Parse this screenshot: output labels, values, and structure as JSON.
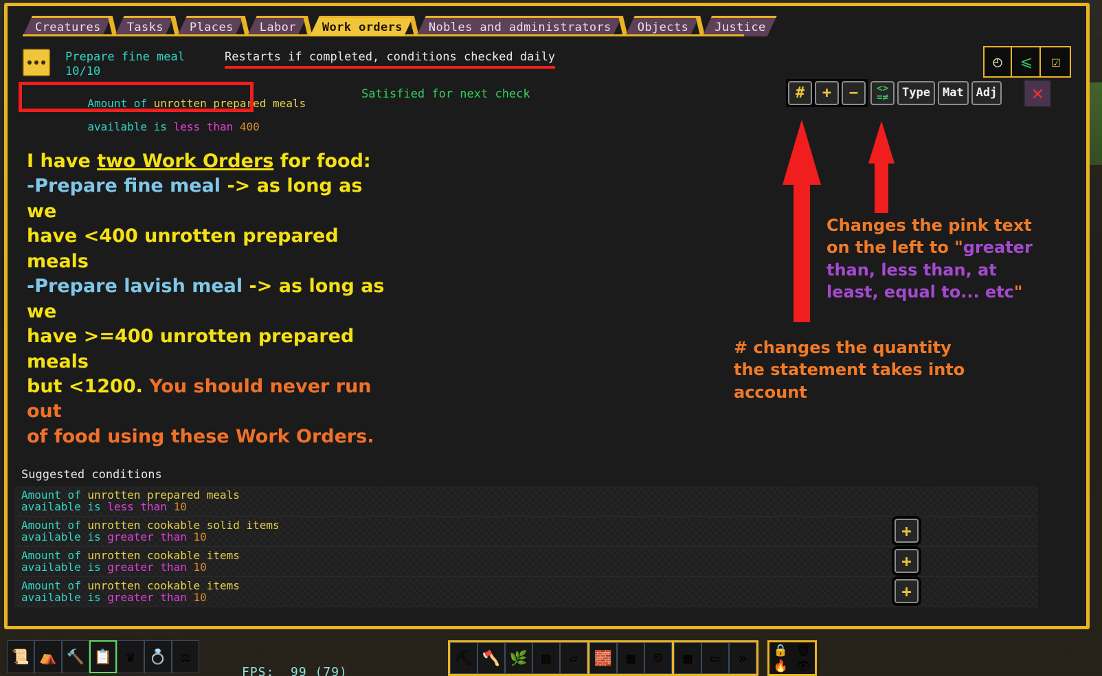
{
  "tabs": [
    {
      "label": "Creatures",
      "active": false
    },
    {
      "label": "Tasks",
      "active": false
    },
    {
      "label": "Places",
      "active": false
    },
    {
      "label": "Labor",
      "active": false
    },
    {
      "label": "Work orders",
      "active": true
    },
    {
      "label": "Nobles and administrators",
      "active": false
    },
    {
      "label": "Objects",
      "active": false
    },
    {
      "label": "Justice",
      "active": false
    }
  ],
  "order": {
    "title": "Prepare fine meal",
    "progress": "10/10",
    "restart_note": "Restarts if completed, conditions checked daily",
    "icon_name": "work-order-dots-icon",
    "status": "Satisfied for next check"
  },
  "active_condition": {
    "seg1": "Amount of ",
    "seg2": "unrotten prepared meals",
    "seg3": "available is ",
    "comparator": "less than",
    "value": "400"
  },
  "header_icons": [
    {
      "name": "clock-icon",
      "glyph": "⏱"
    },
    {
      "name": "comparison-add-icon",
      "glyph": "≤"
    },
    {
      "name": "clipboard-add-icon",
      "glyph": "☑"
    }
  ],
  "condition_toolbar": {
    "quantity_label": "#",
    "increment_label": "+",
    "decrement_label": "−",
    "comparator_glyph": [
      "<",
      ">",
      "=",
      "≠"
    ],
    "type_label": "Type",
    "mat_label": "Mat",
    "adj_label": "Adj",
    "close_label": "✕"
  },
  "annotations": {
    "main": {
      "line1_a": "I have ",
      "line1_b": "two Work Orders",
      "line1_c": " for food:",
      "line2_a": "-Prepare fine meal",
      "line2_b": " -> as long as we",
      "line3": "have <400 unrotten prepared meals",
      "line4_a": "-Prepare lavish meal",
      "line4_b": " -> as long as we",
      "line5": "have >=400 unrotten prepared meals",
      "line6_a": "but <1200. ",
      "line6_b": "You should never run out",
      "line7": "of food using these Work Orders."
    },
    "right": {
      "a": "Changes the pink text on the left to \"",
      "b": "greater than, less than, at least, equal to... etc",
      "c": "\""
    },
    "bottom": "# changes the quantity the statement takes into account"
  },
  "suggested": {
    "title": "Suggested conditions",
    "rows": [
      {
        "seg1": "Amount of ",
        "seg2": "unrotten prepared meals",
        "seg3": "available is ",
        "comparator": "less than",
        "value": "10",
        "has_add": false,
        "add_label": "+"
      },
      {
        "seg1": "Amount of ",
        "seg2": "unrotten cookable solid items",
        "seg3": "available is ",
        "comparator": "greater than",
        "value": "10",
        "has_add": true,
        "add_label": "+"
      },
      {
        "seg1": "Amount of ",
        "seg2": "unrotten cookable items",
        "seg3": "available is ",
        "comparator": "greater than",
        "value": "10",
        "has_add": true,
        "add_label": "+"
      },
      {
        "seg1": "Amount of ",
        "seg2": "unrotten cookable items",
        "seg3": "available is ",
        "comparator": "greater than",
        "value": "10",
        "has_add": true,
        "add_label": "+"
      }
    ]
  },
  "bottom_bar": {
    "fps": "FPS:  99 (79)",
    "left_icons": [
      {
        "name": "scroll-check-icon",
        "glyph": "📜",
        "selected": false
      },
      {
        "name": "tent-place-icon",
        "glyph": "⛺",
        "selected": false
      },
      {
        "name": "hammer-labor-icon",
        "glyph": "🔨",
        "selected": false
      },
      {
        "name": "clipboard-work-orders-icon",
        "glyph": "📋",
        "selected": true
      },
      {
        "name": "crown-nobles-icon",
        "glyph": "♛",
        "selected": false
      },
      {
        "name": "amulet-objects-icon",
        "glyph": "💍",
        "selected": false
      },
      {
        "name": "scales-justice-icon",
        "glyph": "⚖",
        "selected": false
      }
    ],
    "mid_group_1": [
      {
        "name": "pickaxe-mine-icon",
        "glyph": "⛏"
      },
      {
        "name": "axe-chop-tree-icon",
        "glyph": "🪓"
      },
      {
        "name": "plant-gather-icon",
        "glyph": "🌿"
      },
      {
        "name": "stone-smooth-icon",
        "glyph": "▧"
      },
      {
        "name": "eraser-remove-icon",
        "glyph": "▱"
      }
    ],
    "mid_group_2": [
      {
        "name": "build-construction-icon",
        "glyph": "🧱"
      },
      {
        "name": "furniture-build-icon",
        "glyph": "▦"
      },
      {
        "name": "dwarf-portrait-icon",
        "glyph": "☺"
      }
    ],
    "mid_group_3": [
      {
        "name": "zone-grid-icon",
        "glyph": "▦"
      },
      {
        "name": "hauling-vehicle-icon",
        "glyph": "▭"
      },
      {
        "name": "advance-time-icon",
        "glyph": "»"
      }
    ],
    "right_grid": [
      {
        "name": "lock-icon",
        "glyph": "🔒"
      },
      {
        "name": "trash-icon",
        "glyph": "🗑"
      },
      {
        "name": "flame-icon",
        "glyph": "🔥"
      },
      {
        "name": "eye-visibility-icon",
        "glyph": "👁"
      }
    ]
  },
  "colors": {
    "frame": "#e8b424",
    "tab_inactive": "#5e4057",
    "tab_active": "#f0c53a",
    "cyan": "#31d6c6",
    "yellow": "#e8d14a",
    "pink": "#e040d8",
    "orange": "#e08b2e",
    "green": "#2fd35a",
    "red": "#f01e1e",
    "anno_yellow": "#f5e014",
    "anno_blue": "#7fc7e8",
    "anno_orange": "#f07a28",
    "anno_purple": "#a44ad0"
  }
}
